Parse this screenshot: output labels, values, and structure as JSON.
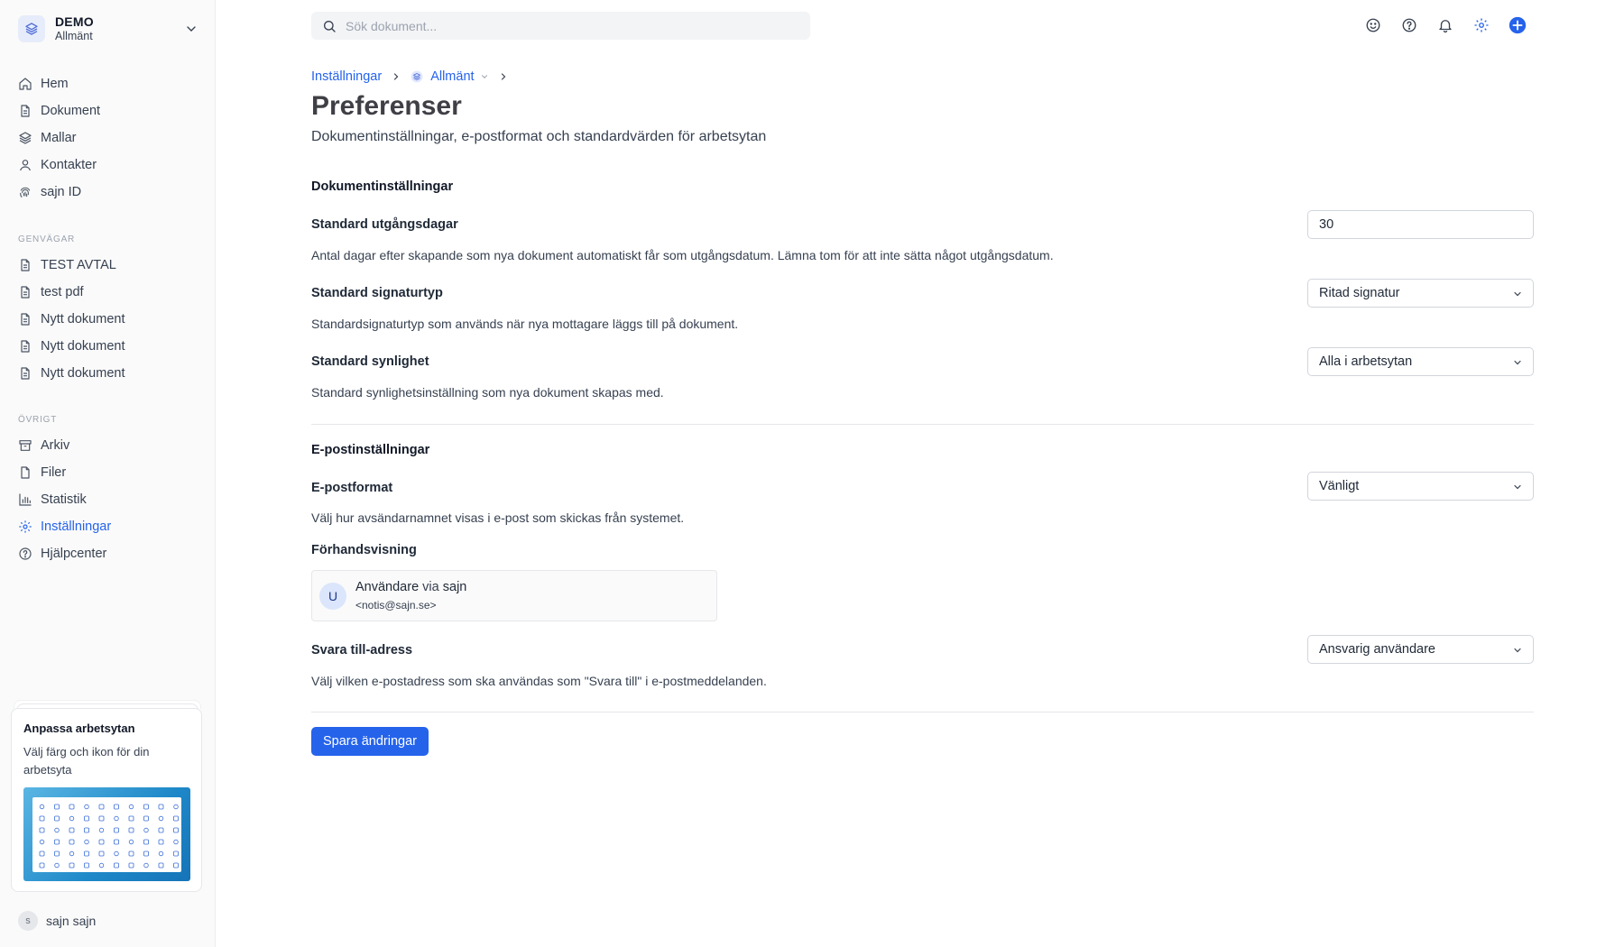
{
  "workspace": {
    "name": "DEMO",
    "subtitle": "Allmänt"
  },
  "sidebar": {
    "main_items": [
      {
        "label": "Hem",
        "icon": "home-icon"
      },
      {
        "label": "Dokument",
        "icon": "document-icon"
      },
      {
        "label": "Mallar",
        "icon": "layers-icon"
      },
      {
        "label": "Kontakter",
        "icon": "user-icon"
      },
      {
        "label": "sajn ID",
        "icon": "fingerprint-icon"
      }
    ],
    "shortcuts_heading": "GENVÄGAR",
    "shortcuts": [
      {
        "label": "TEST AVTAL"
      },
      {
        "label": "test pdf"
      },
      {
        "label": "Nytt dokument"
      },
      {
        "label": "Nytt dokument"
      },
      {
        "label": "Nytt dokument"
      }
    ],
    "other_heading": "ÖVRIGT",
    "other_items": [
      {
        "label": "Arkiv",
        "icon": "archive-icon"
      },
      {
        "label": "Filer",
        "icon": "file-icon"
      },
      {
        "label": "Statistik",
        "icon": "bar-chart-icon"
      },
      {
        "label": "Inställningar",
        "icon": "gear-icon",
        "active": true
      },
      {
        "label": "Hjälpcenter",
        "icon": "help-circle-icon"
      }
    ],
    "promo": {
      "title": "Anpassa arbetsytan",
      "text": "Välj färg och ikon för din arbetsyta"
    },
    "user": {
      "initial": "s",
      "name": "sajn sajn"
    }
  },
  "search": {
    "placeholder": "Sök dokument..."
  },
  "topbar_icons": [
    "smiley-icon",
    "help-circle-icon",
    "bell-icon",
    "gear-icon",
    "plus-circle-icon"
  ],
  "breadcrumb": {
    "root": "Inställningar",
    "workspace": "Allmänt"
  },
  "page": {
    "title": "Preferenser",
    "subtitle": "Dokumentinställningar, e-postformat och standardvärden för arbetsytan"
  },
  "document_settings": {
    "heading": "Dokumentinställningar",
    "expiry": {
      "label": "Standard utgångsdagar",
      "value": "30",
      "help": "Antal dagar efter skapande som nya dokument automatiskt får som utgångsdatum. Lämna tom för att inte sätta något utgångsdatum."
    },
    "signature_type": {
      "label": "Standard signaturtyp",
      "value": "Ritad signatur",
      "help": "Standardsignaturtyp som används när nya mottagare läggs till på dokument."
    },
    "visibility": {
      "label": "Standard synlighet",
      "value": "Alla i arbetsytan",
      "help": "Standard synlighetsinställning som nya dokument skapas med."
    }
  },
  "email_settings": {
    "heading": "E-postinställningar",
    "format": {
      "label": "E-postformat",
      "value": "Vänligt",
      "help": "Välj hur avsändarnamnet visas i e-post som skickas från systemet."
    },
    "preview": {
      "label": "Förhandsvisning",
      "avatar": "U",
      "sender": "Användare",
      "via": "via",
      "brand": "sajn",
      "address": "<notis@sajn.se>"
    },
    "reply_to": {
      "label": "Svara till-adress",
      "value": "Ansvarig användare",
      "help": "Välj vilken e-postadress som ska användas som \"Svara till\" i e-postmeddelanden."
    }
  },
  "actions": {
    "save_label": "Spara ändringar"
  },
  "colors": {
    "accent": "#2563eb",
    "text": "#1f2937",
    "muted": "#9ca3af"
  }
}
